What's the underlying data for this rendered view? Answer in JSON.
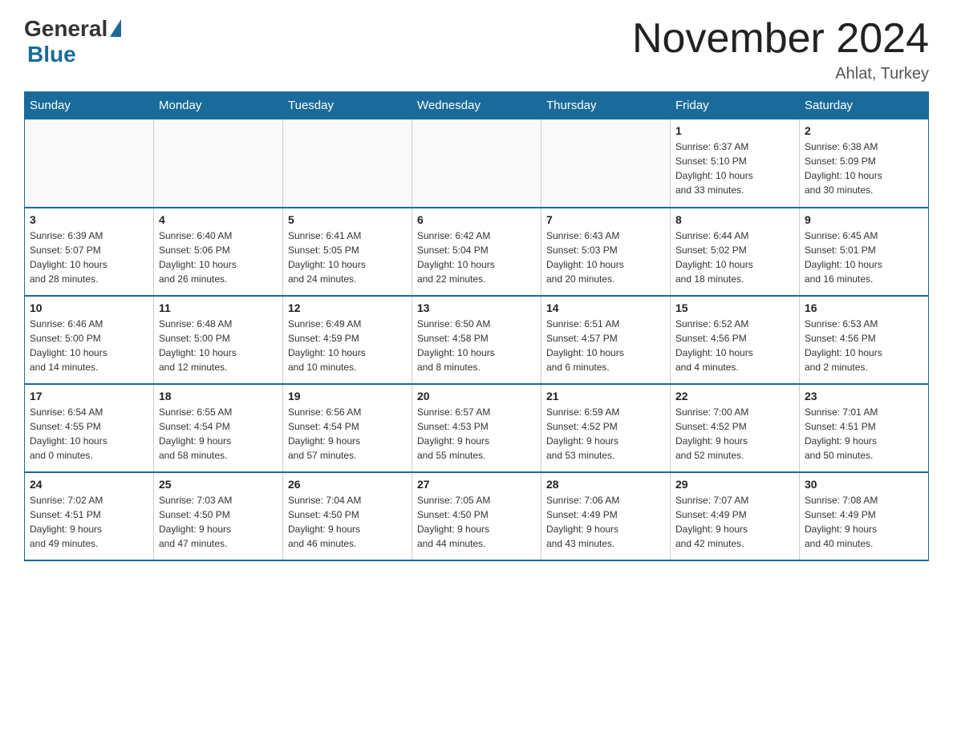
{
  "header": {
    "logo_text": "General",
    "logo_blue": "Blue",
    "title": "November 2024",
    "subtitle": "Ahlat, Turkey"
  },
  "days_of_week": [
    "Sunday",
    "Monday",
    "Tuesday",
    "Wednesday",
    "Thursday",
    "Friday",
    "Saturday"
  ],
  "weeks": [
    [
      {
        "day": "",
        "info": ""
      },
      {
        "day": "",
        "info": ""
      },
      {
        "day": "",
        "info": ""
      },
      {
        "day": "",
        "info": ""
      },
      {
        "day": "",
        "info": ""
      },
      {
        "day": "1",
        "info": "Sunrise: 6:37 AM\nSunset: 5:10 PM\nDaylight: 10 hours\nand 33 minutes."
      },
      {
        "day": "2",
        "info": "Sunrise: 6:38 AM\nSunset: 5:09 PM\nDaylight: 10 hours\nand 30 minutes."
      }
    ],
    [
      {
        "day": "3",
        "info": "Sunrise: 6:39 AM\nSunset: 5:07 PM\nDaylight: 10 hours\nand 28 minutes."
      },
      {
        "day": "4",
        "info": "Sunrise: 6:40 AM\nSunset: 5:06 PM\nDaylight: 10 hours\nand 26 minutes."
      },
      {
        "day": "5",
        "info": "Sunrise: 6:41 AM\nSunset: 5:05 PM\nDaylight: 10 hours\nand 24 minutes."
      },
      {
        "day": "6",
        "info": "Sunrise: 6:42 AM\nSunset: 5:04 PM\nDaylight: 10 hours\nand 22 minutes."
      },
      {
        "day": "7",
        "info": "Sunrise: 6:43 AM\nSunset: 5:03 PM\nDaylight: 10 hours\nand 20 minutes."
      },
      {
        "day": "8",
        "info": "Sunrise: 6:44 AM\nSunset: 5:02 PM\nDaylight: 10 hours\nand 18 minutes."
      },
      {
        "day": "9",
        "info": "Sunrise: 6:45 AM\nSunset: 5:01 PM\nDaylight: 10 hours\nand 16 minutes."
      }
    ],
    [
      {
        "day": "10",
        "info": "Sunrise: 6:46 AM\nSunset: 5:00 PM\nDaylight: 10 hours\nand 14 minutes."
      },
      {
        "day": "11",
        "info": "Sunrise: 6:48 AM\nSunset: 5:00 PM\nDaylight: 10 hours\nand 12 minutes."
      },
      {
        "day": "12",
        "info": "Sunrise: 6:49 AM\nSunset: 4:59 PM\nDaylight: 10 hours\nand 10 minutes."
      },
      {
        "day": "13",
        "info": "Sunrise: 6:50 AM\nSunset: 4:58 PM\nDaylight: 10 hours\nand 8 minutes."
      },
      {
        "day": "14",
        "info": "Sunrise: 6:51 AM\nSunset: 4:57 PM\nDaylight: 10 hours\nand 6 minutes."
      },
      {
        "day": "15",
        "info": "Sunrise: 6:52 AM\nSunset: 4:56 PM\nDaylight: 10 hours\nand 4 minutes."
      },
      {
        "day": "16",
        "info": "Sunrise: 6:53 AM\nSunset: 4:56 PM\nDaylight: 10 hours\nand 2 minutes."
      }
    ],
    [
      {
        "day": "17",
        "info": "Sunrise: 6:54 AM\nSunset: 4:55 PM\nDaylight: 10 hours\nand 0 minutes."
      },
      {
        "day": "18",
        "info": "Sunrise: 6:55 AM\nSunset: 4:54 PM\nDaylight: 9 hours\nand 58 minutes."
      },
      {
        "day": "19",
        "info": "Sunrise: 6:56 AM\nSunset: 4:54 PM\nDaylight: 9 hours\nand 57 minutes."
      },
      {
        "day": "20",
        "info": "Sunrise: 6:57 AM\nSunset: 4:53 PM\nDaylight: 9 hours\nand 55 minutes."
      },
      {
        "day": "21",
        "info": "Sunrise: 6:59 AM\nSunset: 4:52 PM\nDaylight: 9 hours\nand 53 minutes."
      },
      {
        "day": "22",
        "info": "Sunrise: 7:00 AM\nSunset: 4:52 PM\nDaylight: 9 hours\nand 52 minutes."
      },
      {
        "day": "23",
        "info": "Sunrise: 7:01 AM\nSunset: 4:51 PM\nDaylight: 9 hours\nand 50 minutes."
      }
    ],
    [
      {
        "day": "24",
        "info": "Sunrise: 7:02 AM\nSunset: 4:51 PM\nDaylight: 9 hours\nand 49 minutes."
      },
      {
        "day": "25",
        "info": "Sunrise: 7:03 AM\nSunset: 4:50 PM\nDaylight: 9 hours\nand 47 minutes."
      },
      {
        "day": "26",
        "info": "Sunrise: 7:04 AM\nSunset: 4:50 PM\nDaylight: 9 hours\nand 46 minutes."
      },
      {
        "day": "27",
        "info": "Sunrise: 7:05 AM\nSunset: 4:50 PM\nDaylight: 9 hours\nand 44 minutes."
      },
      {
        "day": "28",
        "info": "Sunrise: 7:06 AM\nSunset: 4:49 PM\nDaylight: 9 hours\nand 43 minutes."
      },
      {
        "day": "29",
        "info": "Sunrise: 7:07 AM\nSunset: 4:49 PM\nDaylight: 9 hours\nand 42 minutes."
      },
      {
        "day": "30",
        "info": "Sunrise: 7:08 AM\nSunset: 4:49 PM\nDaylight: 9 hours\nand 40 minutes."
      }
    ]
  ]
}
